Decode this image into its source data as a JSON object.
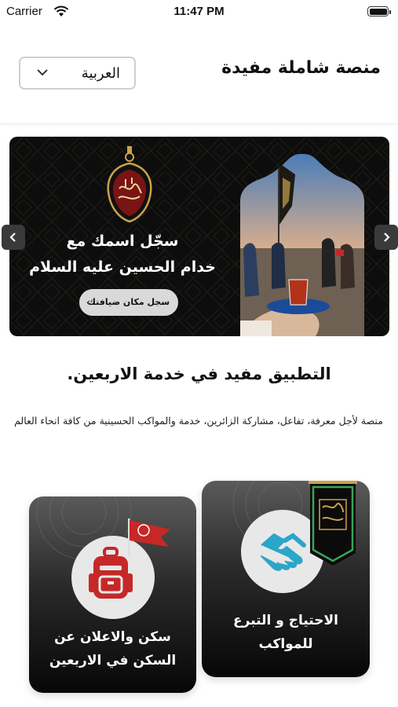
{
  "status_bar": {
    "carrier": "Carrier",
    "time": "11:47 PM"
  },
  "header": {
    "title": "منصة شاملة مفيدة",
    "language": "العربية"
  },
  "banner": {
    "line1": "سجّل اسمك مع",
    "line2": "خدام الحسين عليه السلام",
    "cta": "سجل مكان ضيافتك"
  },
  "intro": {
    "headline": "التطبيق مفيد في خدمة الاربعين.",
    "description": "منصة لأجل معرفة، تفاعل، مشاركة الزائرين، خدمة والمواكب الحسينية من كافة انحاء العالم"
  },
  "cards": [
    {
      "label_line1": "الاحتياج و التبرع",
      "label_line2": "للمواكب",
      "icon": "handshake-icon"
    },
    {
      "label_line1": "سكن والاعلان عن",
      "label_line2": "السكن في الاربعين",
      "icon": "backpack-icon"
    }
  ],
  "colors": {
    "accent_red": "#c62828",
    "handshake_blue": "#2aa6c9",
    "banner_bg": "#0d0d0d",
    "gold": "#c9a24a"
  }
}
